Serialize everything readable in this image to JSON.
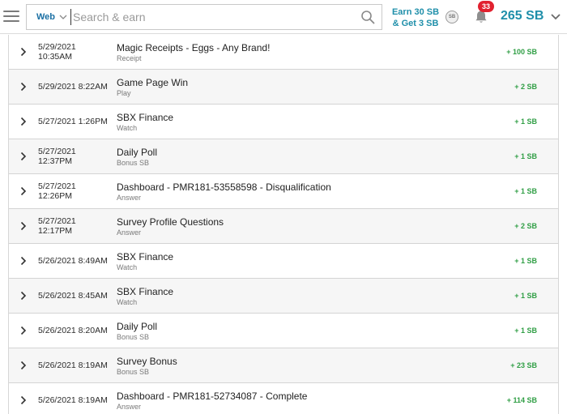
{
  "header": {
    "search": {
      "scope": "Web",
      "placeholder": "Search & earn"
    },
    "earn_promo": {
      "line1": "Earn 30 SB",
      "line2": "& Get 3 SB"
    },
    "coin_label": "SB",
    "notifications": {
      "count": "33"
    },
    "balance": "265 SB"
  },
  "colors": {
    "brand": "#1f8faa",
    "scope_blue": "#1a6fa3",
    "amount_green": "#2f9e44",
    "badge_red": "#e1212f"
  },
  "activity": [
    {
      "date_line1": "5/29/2021",
      "date_line2": "10:35AM",
      "title": "Magic Receipts - Eggs - Any Brand!",
      "type": "Receipt",
      "amount": "+ 100 SB"
    },
    {
      "date_line1": "5/29/2021 8:22AM",
      "date_line2": "",
      "title": "Game Page Win",
      "type": "Play",
      "amount": "+ 2 SB"
    },
    {
      "date_line1": "5/27/2021 1:26PM",
      "date_line2": "",
      "title": "SBX Finance",
      "type": "Watch",
      "amount": "+ 1 SB"
    },
    {
      "date_line1": "5/27/2021",
      "date_line2": "12:37PM",
      "title": "Daily Poll",
      "type": "Bonus SB",
      "amount": "+ 1 SB"
    },
    {
      "date_line1": "5/27/2021",
      "date_line2": "12:26PM",
      "title": "Dashboard - PMR181-53558598 - Disqualification",
      "type": "Answer",
      "amount": "+ 1 SB"
    },
    {
      "date_line1": "5/27/2021",
      "date_line2": "12:17PM",
      "title": "Survey Profile Questions",
      "type": "Answer",
      "amount": "+ 2 SB"
    },
    {
      "date_line1": "5/26/2021 8:49AM",
      "date_line2": "",
      "title": "SBX Finance",
      "type": "Watch",
      "amount": "+ 1 SB"
    },
    {
      "date_line1": "5/26/2021 8:45AM",
      "date_line2": "",
      "title": "SBX Finance",
      "type": "Watch",
      "amount": "+ 1 SB"
    },
    {
      "date_line1": "5/26/2021 8:20AM",
      "date_line2": "",
      "title": "Daily Poll",
      "type": "Bonus SB",
      "amount": "+ 1 SB"
    },
    {
      "date_line1": "5/26/2021 8:19AM",
      "date_line2": "",
      "title": "Survey Bonus",
      "type": "Bonus SB",
      "amount": "+ 23 SB"
    },
    {
      "date_line1": "5/26/2021 8:19AM",
      "date_line2": "",
      "title": "Dashboard - PMR181-52734087 - Complete",
      "type": "Answer",
      "amount": "+ 114 SB"
    }
  ]
}
